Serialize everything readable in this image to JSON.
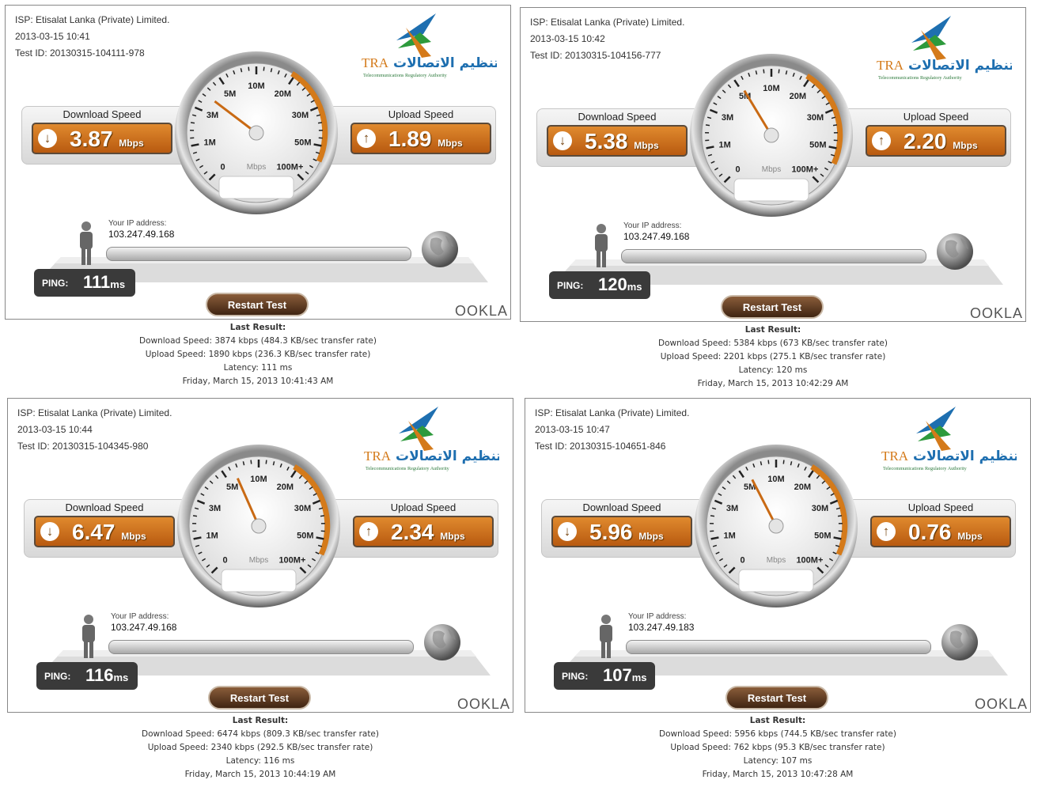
{
  "labels": {
    "download": "Download Speed",
    "upload": "Upload Speed",
    "your_ip": "Your IP address:",
    "ping": "PING:",
    "restart": "Restart Test",
    "last_result": "Last Result:",
    "mbps_unit": "Mbps",
    "ms_unit": "ms",
    "gauge_unit": "Mbps",
    "ookla": "OOKLA",
    "tra_abbr": "TRA",
    "tra_arabic": "هيئة تنظيم الاتصالات",
    "tra_full": "Telecommunications Regulatory Authority",
    "gauge_ticks": [
      "0",
      "1M",
      "3M",
      "5M",
      "10M",
      "20M",
      "30M",
      "50M",
      "100M+"
    ]
  },
  "colors": {
    "accent": "#cc6f1f",
    "dark": "#3a3a3a",
    "frame": "#888888"
  },
  "tests": [
    {
      "isp": "ISP: Etisalat Lanka (Private) Limited.",
      "datetime": "2013-03-15  10:41",
      "test_id": "Test ID: 20130315-104111-978",
      "download": "3.87",
      "upload": "1.89",
      "download_mbps": 3.87,
      "ip": "103.247.49.168",
      "ping": "111",
      "result": {
        "download": "Download Speed: 3874 kbps (484.3 KB/sec transfer rate)",
        "upload": "Upload Speed: 1890 kbps (236.3 KB/sec transfer rate)",
        "latency": "Latency: 111 ms",
        "date": "Friday, March 15, 2013 10:41:43 AM"
      }
    },
    {
      "isp": "ISP: Etisalat Lanka (Private) Limited.",
      "datetime": "2013-03-15  10:42",
      "test_id": "Test ID: 20130315-104156-777",
      "download": "5.38",
      "upload": "2.20",
      "download_mbps": 5.38,
      "ip": "103.247.49.168",
      "ping": "120",
      "result": {
        "download": "Download Speed: 5384 kbps (673 KB/sec transfer rate)",
        "upload": "Upload Speed: 2201 kbps (275.1 KB/sec transfer rate)",
        "latency": "Latency: 120 ms",
        "date": "Friday, March 15, 2013 10:42:29 AM"
      }
    },
    {
      "isp": "ISP: Etisalat Lanka (Private) Limited.",
      "datetime": "2013-03-15  10:44",
      "test_id": "Test ID: 20130315-104345-980",
      "download": "6.47",
      "upload": "2.34",
      "download_mbps": 6.47,
      "ip": "103.247.49.168",
      "ping": "116",
      "result": {
        "download": "Download Speed: 6474 kbps (809.3 KB/sec transfer rate)",
        "upload": "Upload Speed: 2340 kbps (292.5 KB/sec transfer rate)",
        "latency": "Latency: 116 ms",
        "date": "Friday, March 15, 2013 10:44:19 AM"
      }
    },
    {
      "isp": "ISP: Etisalat Lanka (Private) Limited.",
      "datetime": "2013-03-15  10:47",
      "test_id": "Test ID: 20130315-104651-846",
      "download": "5.96",
      "upload": "0.76",
      "download_mbps": 5.96,
      "ip": "103.247.49.183",
      "ping": "107",
      "result": {
        "download": "Download Speed: 5956 kbps (744.5 KB/sec transfer rate)",
        "upload": "Upload Speed: 762 kbps (95.3 KB/sec transfer rate)",
        "latency": "Latency: 107 ms",
        "date": "Friday, March 15, 2013 10:47:28 AM"
      }
    }
  ]
}
